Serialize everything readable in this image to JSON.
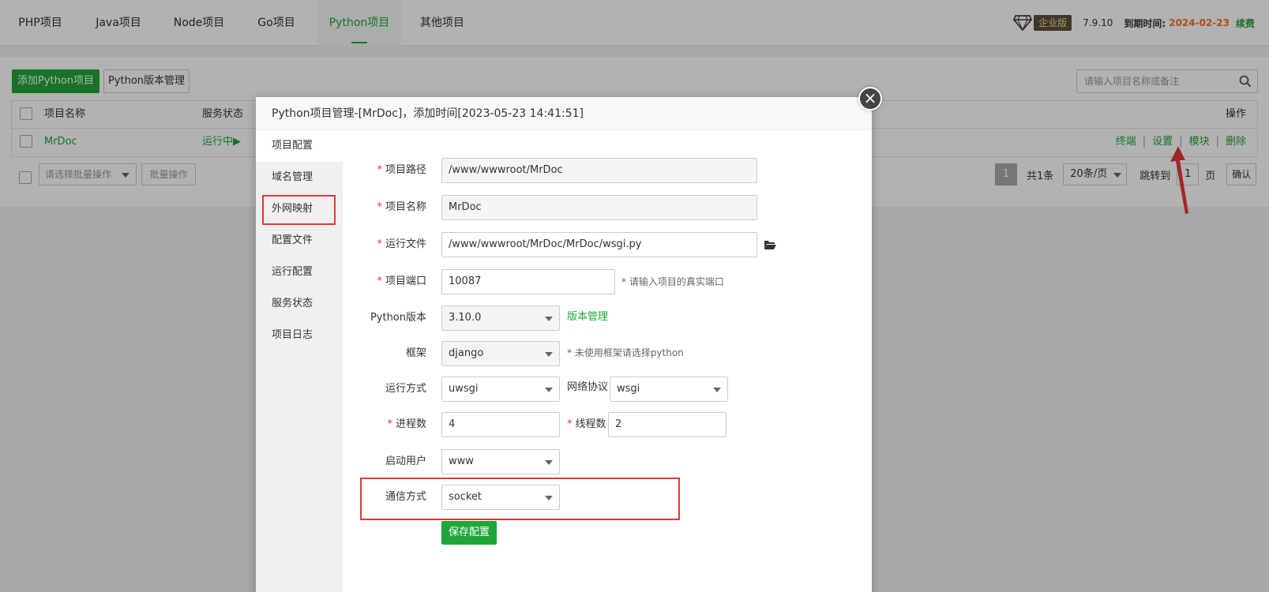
{
  "nav": {
    "tabs": [
      {
        "label": "PHP项目"
      },
      {
        "label": "Java项目"
      },
      {
        "label": "Node项目"
      },
      {
        "label": "Go项目"
      },
      {
        "label": "Python项目"
      },
      {
        "label": "其他项目"
      }
    ],
    "edition_badge": "企业版",
    "version": "7.9.10",
    "expire_label": "到期时间:",
    "expire_date": "2024-02-23",
    "renew": "续费"
  },
  "toolbar": {
    "add_python_project": "添加Python项目",
    "python_version_mgmt": "Python版本管理",
    "search_placeholder": "请输入项目名称或备注"
  },
  "table": {
    "headers": {
      "name": "项目名称",
      "status": "服务状态",
      "ops": "操作"
    },
    "rows": [
      {
        "name": "MrDoc",
        "status": "运行中▶"
      }
    ],
    "row_ops": [
      "终端",
      "设置",
      "模块",
      "删除"
    ]
  },
  "batch": {
    "select_placeholder": "请选择批量操作",
    "button": "批量操作"
  },
  "pager": {
    "current": "1",
    "total": "共1条",
    "per_page": "20条/页",
    "jump_label": "跳转到",
    "jump_value": "1",
    "page_unit": "页",
    "confirm": "确认"
  },
  "modal": {
    "title": "Python项目管理-[MrDoc]，添加时间[2023-05-23 14:41:51]",
    "close": "×",
    "side_items": [
      {
        "label": "项目配置"
      },
      {
        "label": "域名管理"
      },
      {
        "label": "外网映射"
      },
      {
        "label": "配置文件"
      },
      {
        "label": "运行配置"
      },
      {
        "label": "服务状态"
      },
      {
        "label": "项目日志"
      }
    ],
    "form": {
      "path_label": "项目路径",
      "path_value": "/www/wwwroot/MrDoc",
      "name_label": "项目名称",
      "name_value": "MrDoc",
      "run_file_label": "运行文件",
      "run_file_value": "/www/wwwroot/MrDoc/MrDoc/wsgi.py",
      "port_label": "项目端口",
      "port_value": "10087",
      "port_hint": "* 请输入项目的真实端口",
      "python_ver_label": "Python版本",
      "python_ver_value": "3.10.0",
      "version_mgmt_link": "版本管理",
      "framework_label": "框架",
      "framework_value": "django",
      "framework_hint": "* 未使用框架请选择python",
      "run_mode_label": "运行方式",
      "run_mode_value": "uwsgi",
      "protocol_label": "网络协议",
      "protocol_value": "wsgi",
      "processes_label": "进程数",
      "processes_value": "4",
      "threads_label": "线程数",
      "threads_value": "2",
      "user_label": "启动用户",
      "user_value": "www",
      "comm_label": "通信方式",
      "comm_value": "socket",
      "save": "保存配置",
      "required_mark": "*"
    }
  },
  "colors": {
    "accent": "#20a53a",
    "highlight_red": "#e53935",
    "expire": "#fc6d26"
  }
}
